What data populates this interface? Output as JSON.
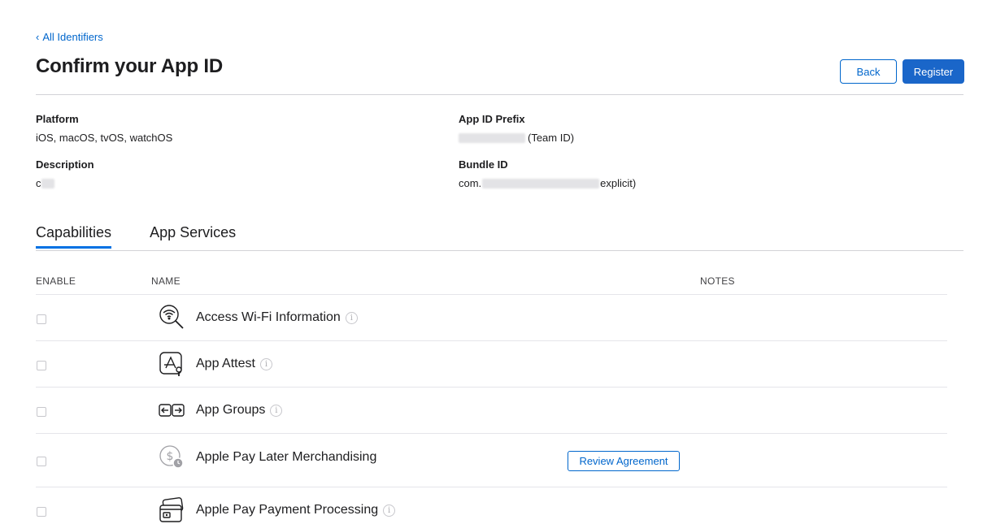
{
  "nav": {
    "back_link": "All Identifiers",
    "chevron": "‹"
  },
  "title": "Confirm your App ID",
  "actions": {
    "back": "Back",
    "register": "Register"
  },
  "info": {
    "platform_label": "Platform",
    "platform_value": "iOS, macOS, tvOS, watchOS",
    "description_label": "Description",
    "description_value": "c",
    "prefix_label": "App ID Prefix",
    "prefix_suffix": "(Team ID)",
    "bundle_label": "Bundle ID",
    "bundle_prefix": "com.",
    "bundle_suffix": "explicit)"
  },
  "tabs": [
    {
      "label": "Capabilities",
      "active": true
    },
    {
      "label": "App Services",
      "active": false
    }
  ],
  "columns": {
    "enable": "ENABLE",
    "name": "NAME",
    "notes": "NOTES"
  },
  "capabilities": [
    {
      "name": "Access Wi-Fi Information",
      "icon": "wifi-search-icon",
      "info": "i"
    },
    {
      "name": "App Attest",
      "icon": "app-attest-icon",
      "info": "i"
    },
    {
      "name": "App Groups",
      "icon": "app-groups-icon",
      "info": "i"
    },
    {
      "name": "Apple Pay Later Merchandising",
      "icon": "apple-pay-later-icon",
      "note_button": "Review Agreement"
    },
    {
      "name": "Apple Pay Payment Processing",
      "icon": "apple-pay-card-icon",
      "info": "i"
    }
  ],
  "colors": {
    "accent": "#0066cc",
    "primary_button": "#1a66c9",
    "divider": "#d2d2d7"
  }
}
